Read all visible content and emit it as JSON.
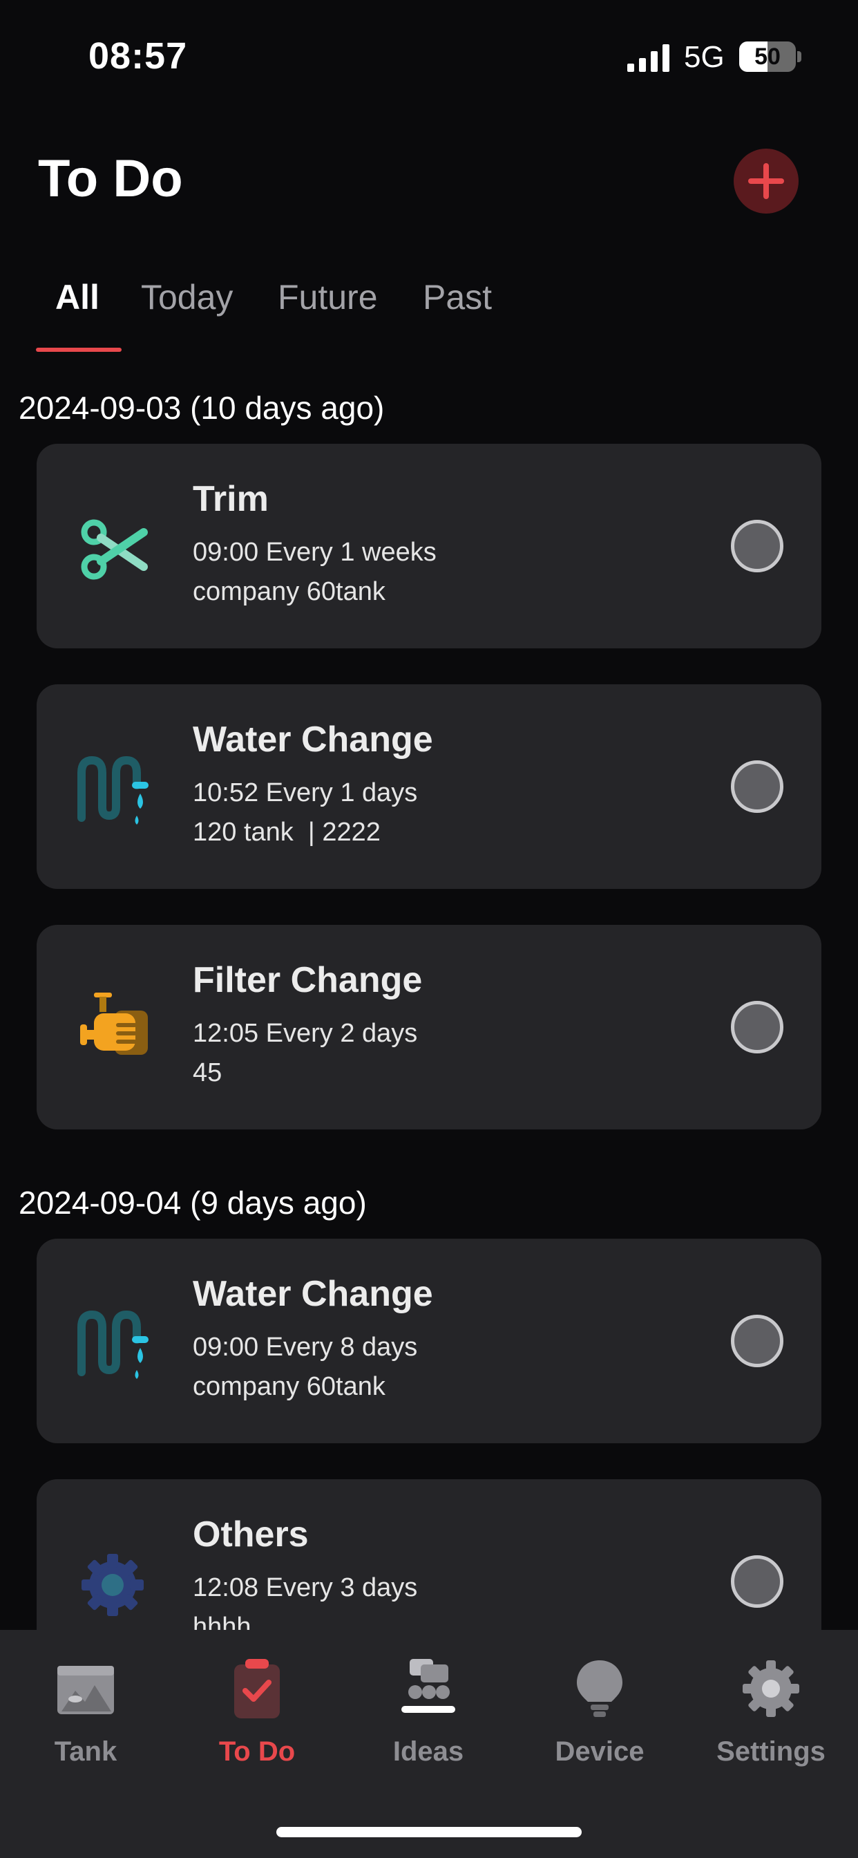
{
  "status_bar": {
    "time": "08:57",
    "network": "5G",
    "battery_level": "50",
    "battery_fraction": 0.5,
    "icons": [
      "signal-icon",
      "battery-icon"
    ]
  },
  "header": {
    "title": "To Do",
    "add_icon": "plus-icon",
    "accent_color": "#e8484c"
  },
  "tabs": [
    {
      "label": "All",
      "active": true
    },
    {
      "label": "Today",
      "active": false
    },
    {
      "label": "Future",
      "active": false
    },
    {
      "label": "Past",
      "active": false
    }
  ],
  "sections": [
    {
      "date_label": "2024-09-03 (10 days ago)",
      "items": [
        {
          "icon": "scissors-icon",
          "title": "Trim",
          "schedule": "09:00 Every 1 weeks",
          "detail": "company 60tank"
        },
        {
          "icon": "water-change-icon",
          "title": "Water Change",
          "schedule": "10:52 Every 1 days",
          "detail": "120 tank  | 2222"
        },
        {
          "icon": "filter-icon",
          "title": "Filter Change",
          "schedule": "12:05 Every 2 days",
          "detail": "45"
        }
      ]
    },
    {
      "date_label": "2024-09-04 (9 days ago)",
      "items": [
        {
          "icon": "water-change-icon",
          "title": "Water Change",
          "schedule": "09:00 Every 8 days",
          "detail": "company 60tank"
        },
        {
          "icon": "gear-icon",
          "title": "Others",
          "schedule": "12:08 Every 3 days",
          "detail": "hhhh"
        }
      ]
    }
  ],
  "tab_bar": [
    {
      "icon": "tank-icon",
      "label": "Tank",
      "active": false
    },
    {
      "icon": "clipboard-check-icon",
      "label": "To Do",
      "active": true
    },
    {
      "icon": "ideas-icon",
      "label": "Ideas",
      "active": false
    },
    {
      "icon": "bulb-icon",
      "label": "Device",
      "active": false
    },
    {
      "icon": "settings-gear-icon",
      "label": "Settings",
      "active": false
    }
  ]
}
